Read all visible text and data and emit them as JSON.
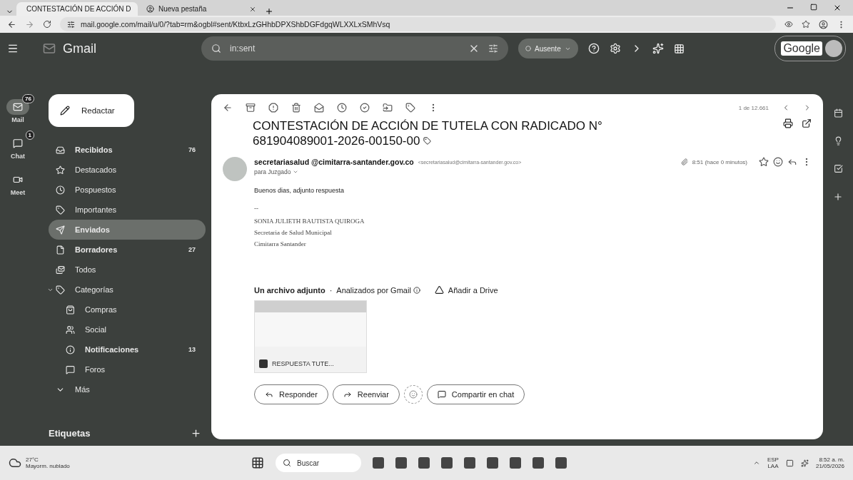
{
  "browser": {
    "tabs": [
      {
        "title": "CONTESTACIÓN DE ACCIÓN D",
        "selected": true
      },
      {
        "title": "Nueva pestaña",
        "selected": false
      }
    ],
    "url": "mail.google.com/mail/u/0/?tab=rm&ogbl#sent/KtbxLzGHhbDPXShbDGFdgqWLXXLxSMhVsq"
  },
  "header": {
    "app_name": "Gmail",
    "search": {
      "value": "in:sent"
    },
    "status": "Ausente",
    "account_label": "Google"
  },
  "rail": [
    {
      "label": "Mail",
      "badge": "76",
      "selected": true
    },
    {
      "label": "Chat",
      "badge": "1",
      "selected": false
    },
    {
      "label": "Meet",
      "selected": false
    }
  ],
  "compose": "Redactar",
  "folders": [
    {
      "label": "Recibidos",
      "count": "76",
      "unread": true,
      "selected": false
    },
    {
      "label": "Destacados",
      "unread": false,
      "selected": false
    },
    {
      "label": "Pospuestos",
      "unread": false,
      "selected": false
    },
    {
      "label": "Importantes",
      "unread": false,
      "selected": false
    },
    {
      "label": "Enviados",
      "unread": true,
      "selected": true
    },
    {
      "label": "Borradores",
      "count": "27",
      "unread": true,
      "selected": false
    },
    {
      "label": "Todos",
      "unread": false,
      "selected": false
    },
    {
      "label": "Categorías",
      "unread": false,
      "selected": false,
      "expanded": true,
      "children": [
        {
          "label": "Compras",
          "unread": false,
          "selected": false
        },
        {
          "label": "Social",
          "unread": false,
          "selected": false
        },
        {
          "label": "Notificaciones",
          "count": "13",
          "unread": true,
          "selected": false
        },
        {
          "label": "Foros",
          "unread": false,
          "selected": false
        }
      ]
    },
    {
      "label": "Más",
      "unread": false,
      "selected": false
    }
  ],
  "labels_heading": "Etiquetas",
  "message": {
    "pager": "1 de 12.661",
    "subject": "CONTESTACIÓN DE ACCIÓN DE TUTELA CON RADICADO N° 681904089001-2026-00150-00",
    "sender_name": "secretariasalud @cimitarra-santander.gov.co",
    "sender_email": "<secretariasalud@cimitarra-santander.gov.co>",
    "time": "8:51 (hace 0 minutos)",
    "recipient": "para Juzgado",
    "body": [
      "Buenos dias, adjunto respuesta"
    ],
    "signature": [
      "--",
      "SONIA JULIETH BAUTISTA QUIROGA",
      "Secretaria de Salud Municipal",
      "Cimitarra Santander"
    ],
    "attachments_heading": "Un archivo adjunto",
    "separator": "·",
    "scan_note": "Analizados por Gmail",
    "drive_action": "Añadir a Drive",
    "attachment": {
      "name": "RESPUESTA TUTE..."
    },
    "actions": [
      "Responder",
      "Reenviar",
      "Compartir en chat"
    ]
  },
  "taskbar": {
    "weather_temp": "27°C",
    "weather_text": "Mayorm. nublado",
    "search": "Buscar",
    "lang_top": "ESP",
    "lang_bottom": "LAA",
    "time": "8:52 a. m.",
    "date": "21/05/2026"
  }
}
